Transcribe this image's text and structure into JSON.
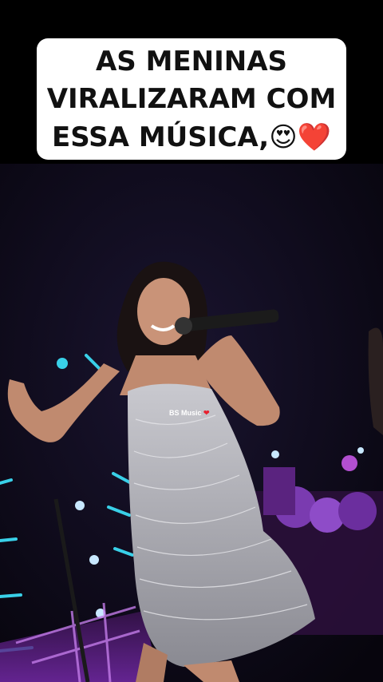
{
  "caption": {
    "line1": "AS MENINAS",
    "line2": "VIRALIZARAM COM",
    "line3": "ESSA MÚSICA,😍❤️"
  },
  "watermark": {
    "text": "BS Music",
    "heart": "❤"
  },
  "scene": {
    "subject": "singer-with-microphone",
    "background_color": "#0b0716",
    "stage_light_color": "#39d0e8",
    "accent_purple": "#9b3fd6"
  }
}
